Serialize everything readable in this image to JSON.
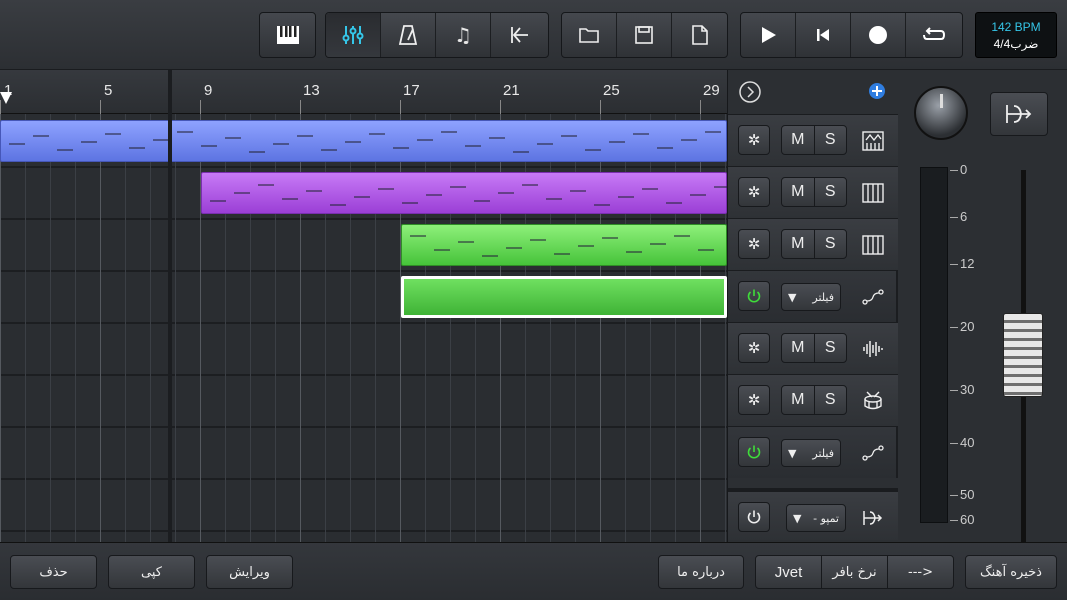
{
  "toolbar": {
    "bpm": "142 BPM",
    "time_sig": "4/4ضرب"
  },
  "ruler": {
    "labels": [
      "1",
      "5",
      "9",
      "13",
      "17",
      "21",
      "25",
      "29"
    ]
  },
  "mixer": {
    "filter_label": "فیلتر",
    "tempo_label": "- تمپو",
    "mute": "M",
    "solo": "S"
  },
  "master": {
    "db_marks": [
      "0",
      "6",
      "12",
      "20",
      "30",
      "40",
      "50",
      "60"
    ]
  },
  "bottom": {
    "delete": "حذف",
    "copy": "کپی",
    "edit": "ویرایش",
    "about": "درباره ما",
    "jvet": "Jvet",
    "buffer": "نرخ بافر",
    "arrow": "--->",
    "save": "ذخیره آهنگ"
  },
  "colors": {
    "accent": "#35c6e8",
    "blue_clip": "#6f86f0",
    "purple_clip": "#b05ee8",
    "green_clip": "#5ad84a"
  }
}
